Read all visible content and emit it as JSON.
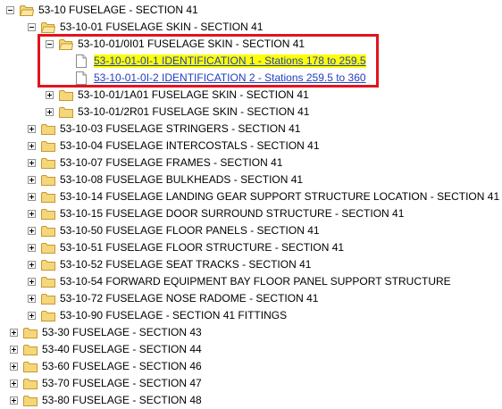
{
  "tree": {
    "items": [
      {
        "label": "53-10 FUSELAGE - SECTION 41",
        "toggle": "minus",
        "icon": "folder-open-icon"
      },
      {
        "label": "53-10-01 FUSELAGE SKIN - SECTION 41",
        "toggle": "minus",
        "icon": "folder-open-icon"
      },
      {
        "label": "53-10-01/0I01 FUSELAGE SKIN - SECTION 41",
        "toggle": "minus",
        "icon": "folder-open-icon"
      },
      {
        "label": "53-10-01-0I-1 IDENTIFICATION 1 - Stations 178 to 259.5",
        "icon": "document-icon",
        "link": true,
        "selected": true
      },
      {
        "label": "53-10-01-0I-2 IDENTIFICATION 2 - Stations 259.5 to 360",
        "icon": "document-icon",
        "link": true
      },
      {
        "label": "53-10-01/1A01 FUSELAGE SKIN - SECTION 41",
        "toggle": "plus",
        "icon": "folder-icon"
      },
      {
        "label": "53-10-01/2R01 FUSELAGE SKIN - SECTION 41",
        "toggle": "plus",
        "icon": "folder-icon"
      },
      {
        "label": "53-10-03 FUSELAGE STRINGERS - SECTION 41",
        "toggle": "plus",
        "icon": "folder-icon"
      },
      {
        "label": "53-10-04 FUSELAGE INTERCOSTALS - SECTION 41",
        "toggle": "plus",
        "icon": "folder-icon"
      },
      {
        "label": "53-10-07 FUSELAGE FRAMES - SECTION 41",
        "toggle": "plus",
        "icon": "folder-icon"
      },
      {
        "label": "53-10-08 FUSELAGE BULKHEADS - SECTION 41",
        "toggle": "plus",
        "icon": "folder-icon"
      },
      {
        "label": "53-10-14 FUSELAGE LANDING GEAR SUPPORT STRUCTURE LOCATION - SECTION 41",
        "toggle": "plus",
        "icon": "folder-icon"
      },
      {
        "label": "53-10-15 FUSELAGE DOOR SURROUND STRUCTURE - SECTION 41",
        "toggle": "plus",
        "icon": "folder-icon"
      },
      {
        "label": "53-10-50 FUSELAGE FLOOR PANELS - SECTION 41",
        "toggle": "plus",
        "icon": "folder-icon"
      },
      {
        "label": "53-10-51 FUSELAGE FLOOR STRUCTURE - SECTION 41",
        "toggle": "plus",
        "icon": "folder-icon"
      },
      {
        "label": "53-10-52 FUSELAGE SEAT TRACKS - SECTION 41",
        "toggle": "plus",
        "icon": "folder-icon"
      },
      {
        "label": "53-10-54 FORWARD EQUIPMENT BAY FLOOR PANEL SUPPORT STRUCTURE",
        "toggle": "plus",
        "icon": "folder-icon"
      },
      {
        "label": "53-10-72 FUSELAGE NOSE RADOME - SECTION 41",
        "toggle": "plus",
        "icon": "folder-icon"
      },
      {
        "label": "53-10-90 FUSELAGE - SECTION 41 FITTINGS",
        "toggle": "plus",
        "icon": "folder-icon"
      },
      {
        "label": "53-30 FUSELAGE - SECTION 43",
        "toggle": "plus",
        "icon": "folder-icon"
      },
      {
        "label": "53-40 FUSELAGE - SECTION 44",
        "toggle": "plus",
        "icon": "folder-icon"
      },
      {
        "label": "53-60 FUSELAGE - SECTION 46",
        "toggle": "plus",
        "icon": "folder-icon"
      },
      {
        "label": "53-70 FUSELAGE - SECTION 47",
        "toggle": "plus",
        "icon": "folder-icon"
      },
      {
        "label": "53-80 FUSELAGE - SECTION 48",
        "toggle": "plus",
        "icon": "folder-icon"
      }
    ]
  },
  "colors": {
    "link": "#1f3fc1",
    "selected_background": "#ffff00",
    "annotation_border": "#e0141e",
    "folder_fill": "#f5d67a",
    "folder_stroke": "#c59a2c"
  }
}
